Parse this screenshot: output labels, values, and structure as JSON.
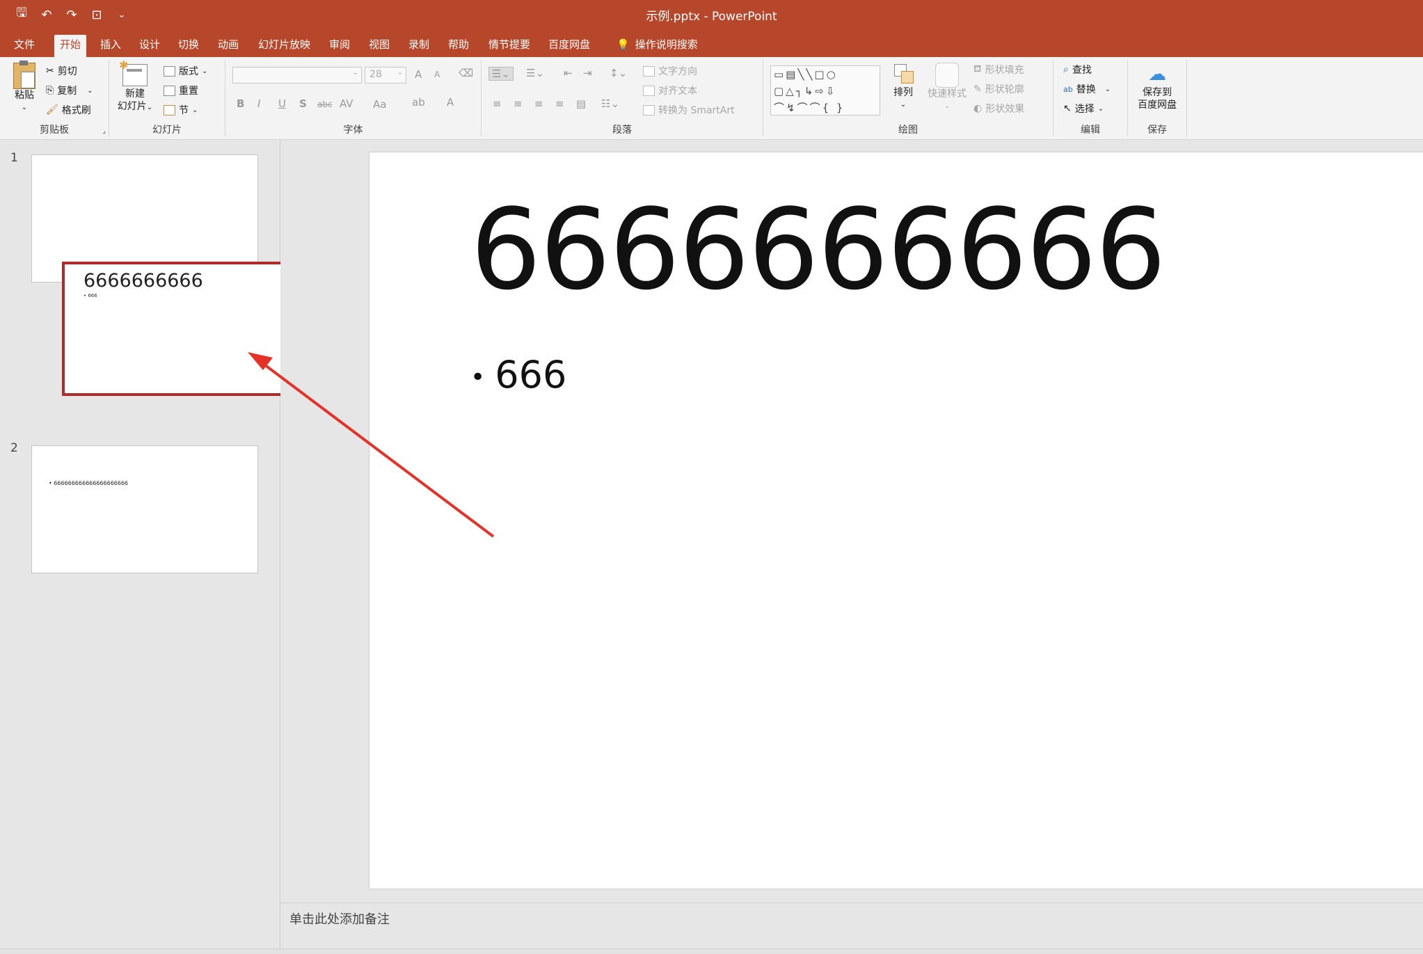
{
  "window": {
    "title": "示例.pptx  -  PowerPoint"
  },
  "quick_access": [
    {
      "name": "save-icon",
      "glyph": "🖫"
    },
    {
      "name": "undo-icon",
      "glyph": "↶"
    },
    {
      "name": "redo-icon",
      "glyph": "↷"
    },
    {
      "name": "present-icon",
      "glyph": "⊡"
    },
    {
      "name": "customize-icon",
      "glyph": "⌄"
    }
  ],
  "menu": {
    "file": "文件",
    "home": "开始",
    "insert": "插入",
    "design": "设计",
    "transitions": "切换",
    "animations": "动画",
    "slideshow": "幻灯片放映",
    "review": "审阅",
    "view": "视图",
    "record": "录制",
    "help": "帮助",
    "storyline": "情节提要",
    "baidu": "百度网盘",
    "tell_me": "操作说明搜索"
  },
  "ribbon": {
    "clipboard": {
      "label": "剪贴板",
      "paste": "粘贴",
      "cut": "剪切",
      "copy": "复制",
      "format_painter": "格式刷"
    },
    "slides": {
      "label": "幻灯片",
      "new_slide_1": "新建",
      "new_slide_2": "幻灯片",
      "layout": "版式",
      "reset": "重置",
      "section": "节"
    },
    "font": {
      "label": "字体",
      "font_name": "",
      "font_size": "28",
      "grow": "A",
      "shrink": "A",
      "bold": "B",
      "italic": "I",
      "underline": "U",
      "shadow": "S",
      "strike": "abc",
      "spacing": "AV",
      "case": "Aa",
      "highlight": "ab",
      "color": "A"
    },
    "paragraph": {
      "label": "段落",
      "text_direction": "文字方向",
      "align_text": "对齐文本",
      "smartart": "转换为 SmartArt"
    },
    "drawing": {
      "label": "绘图",
      "arrange": "排列",
      "quick_styles": "快速样式",
      "fill": "形状填充",
      "outline": "形状轮廓",
      "effects": "形状效果",
      "shapes_row1": "▭▤╲╲□○",
      "shapes_row2": "▢△┐↳⇨⇩",
      "shapes_row3": "⌒↯⌒⌒{ }"
    },
    "editing": {
      "label": "编辑",
      "find": "查找",
      "replace": "替换",
      "select": "选择"
    },
    "save": {
      "label": "保存",
      "save_to_1": "保存到",
      "save_to_2": "百度网盘"
    }
  },
  "slides": [
    {
      "number": "1",
      "title": "6666666666",
      "bullet": "• 666"
    },
    {
      "number": "2",
      "bullet": "• 666666666666666666666"
    }
  ],
  "main_slide": {
    "title": "6666666666",
    "bullet_mark": "•",
    "bullet_text": "666"
  },
  "notes": {
    "placeholder": "单击此处添加备注"
  },
  "colors": {
    "accent": "#b7472a",
    "highlight_box": "#b0292b",
    "arrow": "#e53228"
  }
}
